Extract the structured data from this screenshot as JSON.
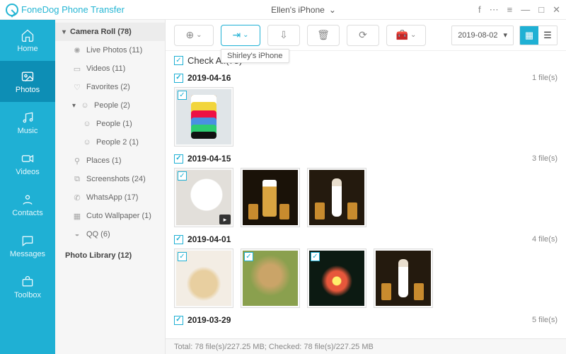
{
  "app_title": "FoneDog Phone Transfer",
  "device": "Ellen's iPhone",
  "tooltip": "Shirley's iPhone",
  "nav": {
    "home": "Home",
    "photos": "Photos",
    "music": "Music",
    "videos": "Videos",
    "contacts": "Contacts",
    "messages": "Messages",
    "toolbox": "Toolbox"
  },
  "sidebar": {
    "camera_roll": "Camera Roll (78)",
    "live": "Live Photos (11)",
    "videos": "Videos (11)",
    "favorites": "Favorites (2)",
    "people": "People (2)",
    "people1": "People (1)",
    "people2": "People 2 (1)",
    "places": "Places (1)",
    "screenshots": "Screenshots (24)",
    "whatsapp": "WhatsApp (17)",
    "cuto": "Cuto Wallpaper (1)",
    "qq": "QQ (6)",
    "photo_library": "Photo Library (12)"
  },
  "date_filter": "2019-08-02",
  "check_all": "Check All(78)",
  "groups": [
    {
      "date": "2019-04-16",
      "count": "1 file(s)",
      "thumbs": [
        {
          "cls": "ph-phone",
          "vid": false
        }
      ]
    },
    {
      "date": "2019-04-15",
      "count": "3 file(s)",
      "thumbs": [
        {
          "cls": "ph-mug",
          "vid": true
        },
        {
          "cls": "ph-beer",
          "vid": false
        },
        {
          "cls": "ph-salt",
          "vid": false
        }
      ]
    },
    {
      "date": "2019-04-01",
      "count": "4 file(s)",
      "thumbs": [
        {
          "cls": "ph-pup1",
          "vid": false
        },
        {
          "cls": "ph-pup2",
          "vid": false
        },
        {
          "cls": "ph-night",
          "vid": false
        },
        {
          "cls": "ph-salt",
          "vid": false
        }
      ]
    },
    {
      "date": "2019-03-29",
      "count": "5 file(s)",
      "thumbs": []
    }
  ],
  "footer": "Total: 78 file(s)/227.25 MB;  Checked: 78 file(s)/227.25 MB"
}
